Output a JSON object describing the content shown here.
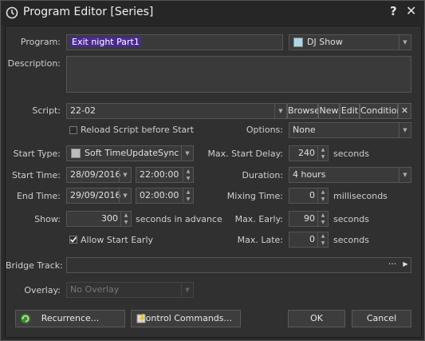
{
  "window": {
    "title": "Program Editor [Series]",
    "help": "?",
    "close": "✕"
  },
  "program": {
    "label": "Program:",
    "value": "Exit night Part1",
    "show_type": "DJ Show",
    "show_swatch": "#a9d8e8"
  },
  "description": {
    "label": "Description:",
    "value": ""
  },
  "script": {
    "label": "Script:",
    "value": "22-02",
    "browse": "Browse",
    "new": "New",
    "edit": "Edit",
    "condition": "Condition",
    "clear": "✕"
  },
  "reload": {
    "label": "Reload Script before Start",
    "checked": false
  },
  "options": {
    "label": "Options:",
    "value": "None"
  },
  "start_type": {
    "label": "Start Type:",
    "value": "Soft TimeUpdateSync"
  },
  "max_start_delay": {
    "label": "Max. Start Delay:",
    "value": "240",
    "unit": "seconds"
  },
  "start_time": {
    "label": "Start Time:",
    "date": "28/09/2016",
    "time": "22:00:00"
  },
  "duration": {
    "label": "Duration:",
    "value": "4 hours"
  },
  "end_time": {
    "label": "End Time:",
    "date": "29/09/2016",
    "time": "02:00:00"
  },
  "mixing_time": {
    "label": "Mixing Time:",
    "value": "0",
    "unit": "milliseconds"
  },
  "show": {
    "label": "Show:",
    "value": "300",
    "unit": "seconds in advance"
  },
  "max_early": {
    "label": "Max. Early:",
    "value": "90",
    "unit": "seconds"
  },
  "allow_start_early": {
    "label": "Allow Start Early",
    "checked": true
  },
  "max_late": {
    "label": "Max. Late:",
    "value": "0",
    "unit": "seconds"
  },
  "bridge_track": {
    "label": "Bridge Track:",
    "value": "",
    "more": "···",
    "play": "▶"
  },
  "overlay": {
    "label": "Overlay:",
    "value": "No Overlay"
  },
  "buttons": {
    "recurrence": "Recurrence...",
    "control_commands": "Control Commands...",
    "ok": "OK",
    "cancel": "Cancel"
  }
}
